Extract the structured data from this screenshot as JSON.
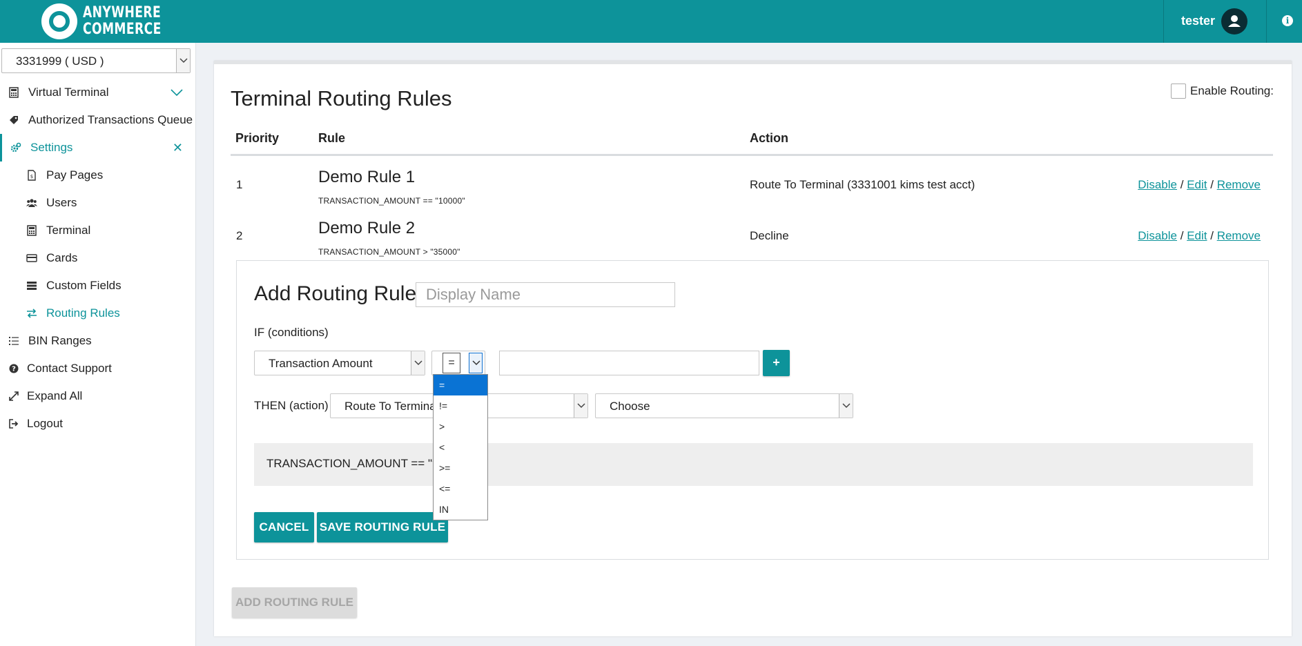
{
  "brand": {
    "line1": "ANYWHERE",
    "line2": "COMMERCE"
  },
  "header": {
    "user_name": "tester"
  },
  "sidebar": {
    "account": "3331999 ( USD )",
    "items": [
      {
        "label": "Virtual Terminal",
        "icon": "calculator-icon"
      },
      {
        "label": "Authorized Transactions Queue",
        "icon": "tag-icon"
      },
      {
        "label": "Settings",
        "icon": "cogs-icon"
      },
      {
        "label": "Pay Pages",
        "icon": "file-icon"
      },
      {
        "label": "Users",
        "icon": "users-icon"
      },
      {
        "label": "Terminal",
        "icon": "calculator-icon"
      },
      {
        "label": "Cards",
        "icon": "credit-card-icon"
      },
      {
        "label": "Custom Fields",
        "icon": "server-icon"
      },
      {
        "label": "Routing Rules",
        "icon": "exchange-icon"
      },
      {
        "label": "BIN Ranges",
        "icon": "list-icon"
      },
      {
        "label": "Contact Support",
        "icon": "question-icon"
      },
      {
        "label": "Expand All",
        "icon": "expand-icon"
      },
      {
        "label": "Logout",
        "icon": "sign-out-icon"
      }
    ]
  },
  "main": {
    "title": "Terminal Routing Rules",
    "enable_routing_label": "Enable Routing:",
    "columns": {
      "priority": "Priority",
      "rule": "Rule",
      "action": "Action"
    },
    "rules": [
      {
        "priority": "1",
        "name": "Demo Rule 1",
        "expression": "TRANSACTION_AMOUNT == \"10000\"",
        "action": "Route To Terminal (3331001 kims test acct)"
      },
      {
        "priority": "2",
        "name": "Demo Rule 2",
        "expression": "TRANSACTION_AMOUNT > \"35000\"",
        "action": "Decline"
      }
    ],
    "row_links": {
      "disable": "Disable",
      "edit": "Edit",
      "remove": "Remove",
      "sep": "/"
    },
    "add_rule_button": "ADD ROUTING RULE"
  },
  "add_form": {
    "title": "Add Routing Rule",
    "display_name_placeholder": "Display Name",
    "if_label": "IF (conditions)",
    "field_select": "Transaction Amount",
    "operator_value": "=",
    "plus_label": "+",
    "then_label": "THEN (action)",
    "action_select": "Route To Terminal",
    "target_select": "Choose",
    "preview": "TRANSACTION_AMOUNT == \"?\"",
    "cancel_label": "CANCEL",
    "save_label": "SAVE ROUTING RULE"
  },
  "operator_options": [
    "=",
    "!=",
    ">",
    "<",
    ">=",
    "<=",
    "IN"
  ],
  "colors": {
    "brand": "#0d939a",
    "highlight": "#0a73d4",
    "link": "#0d939a"
  }
}
